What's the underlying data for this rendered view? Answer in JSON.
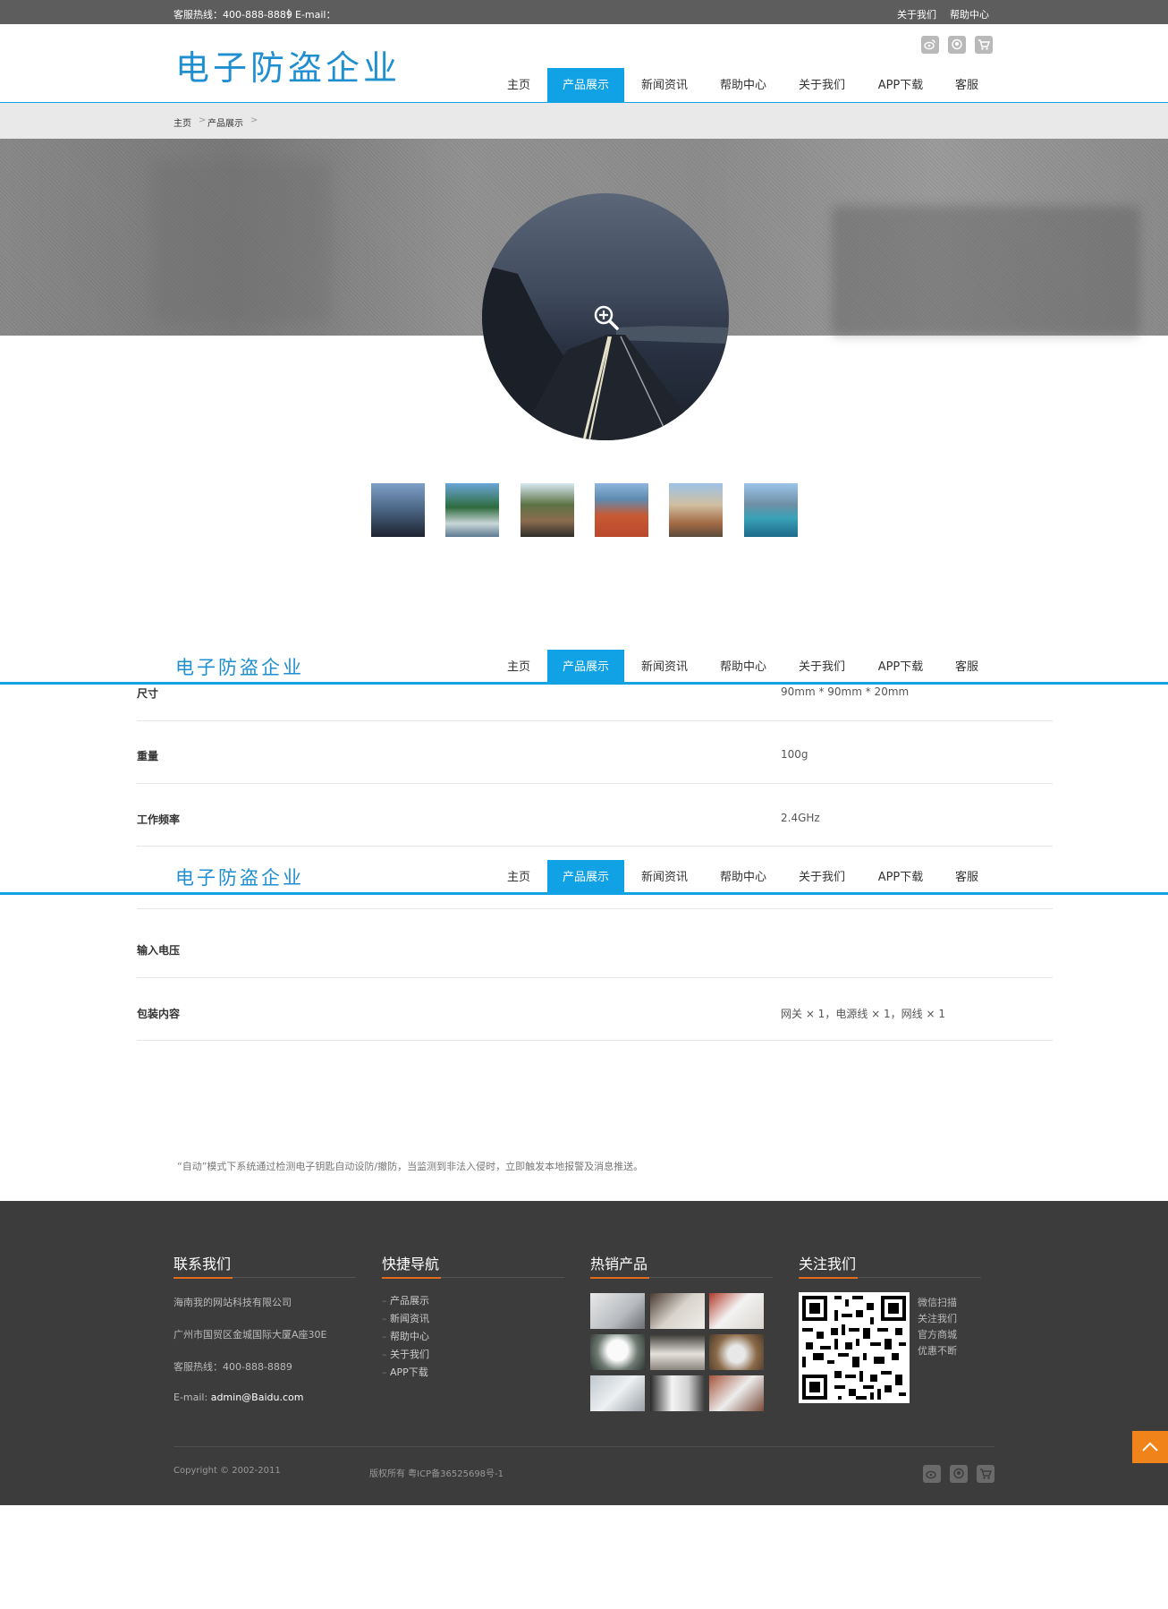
{
  "topbar": {
    "hotline": "客服热线：400-888-8889",
    "separator": "|",
    "email": "E-mail：",
    "about": "关于我们",
    "help": "帮助中心"
  },
  "header": {
    "logo": "电子防盗企业",
    "icons": [
      "weibo-icon",
      "qq-icon",
      "cart-icon"
    ]
  },
  "nav": {
    "items": [
      "主页",
      "产品展示",
      "新闻资讯",
      "帮助中心",
      "关于我们",
      "APP下载",
      "客服"
    ],
    "active": "产品展示",
    "accent": "#11a2e6"
  },
  "breadcrumb": {
    "home": "主页",
    "current": "产品展示",
    "sep": ">"
  },
  "gallery": {
    "thumbnails": 6,
    "zoom_icon": "zoom-in-icon"
  },
  "specs": [
    {
      "label": "尺寸",
      "value": "90mm * 90mm * 20mm"
    },
    {
      "label": "重量",
      "value": "100g"
    },
    {
      "label": "工作频率",
      "value": "2.4GHz"
    },
    {
      "label": "输入电压",
      "value": ""
    },
    {
      "label": "包装内容",
      "value": "网关 × 1，电源线 × 1，网线 × 1"
    }
  ],
  "note": "“自动”模式下系统通过检测电子钥匙自动设防/撤防，当监测到非法入侵时，立即触发本地报警及消息推送。",
  "footer": {
    "contact": {
      "title": "联系我们",
      "company": "海南我的网站科技有限公司",
      "address": "广州市国贸区金城国际大厦A座30E",
      "hotline": "客服热线：400-888-8889",
      "email_label": "E-mail: ",
      "email": "admin@Baidu.com"
    },
    "quicknav": {
      "title": "快捷导航",
      "links": [
        "产品展示",
        "新闻资讯",
        "帮助中心",
        "关于我们",
        "APP下载"
      ]
    },
    "hot": {
      "title": "热销产品",
      "count": 9
    },
    "follow": {
      "title": "关注我们",
      "lines": [
        "微信扫描",
        "关注我们",
        "官方商城",
        "优惠不断"
      ]
    },
    "copyright": "Copyright © 2002-2011",
    "record": "版权所有  粤ICP备36525698号-1",
    "accent": "#e26b1c"
  },
  "back_to_top": "chevron-up-icon"
}
